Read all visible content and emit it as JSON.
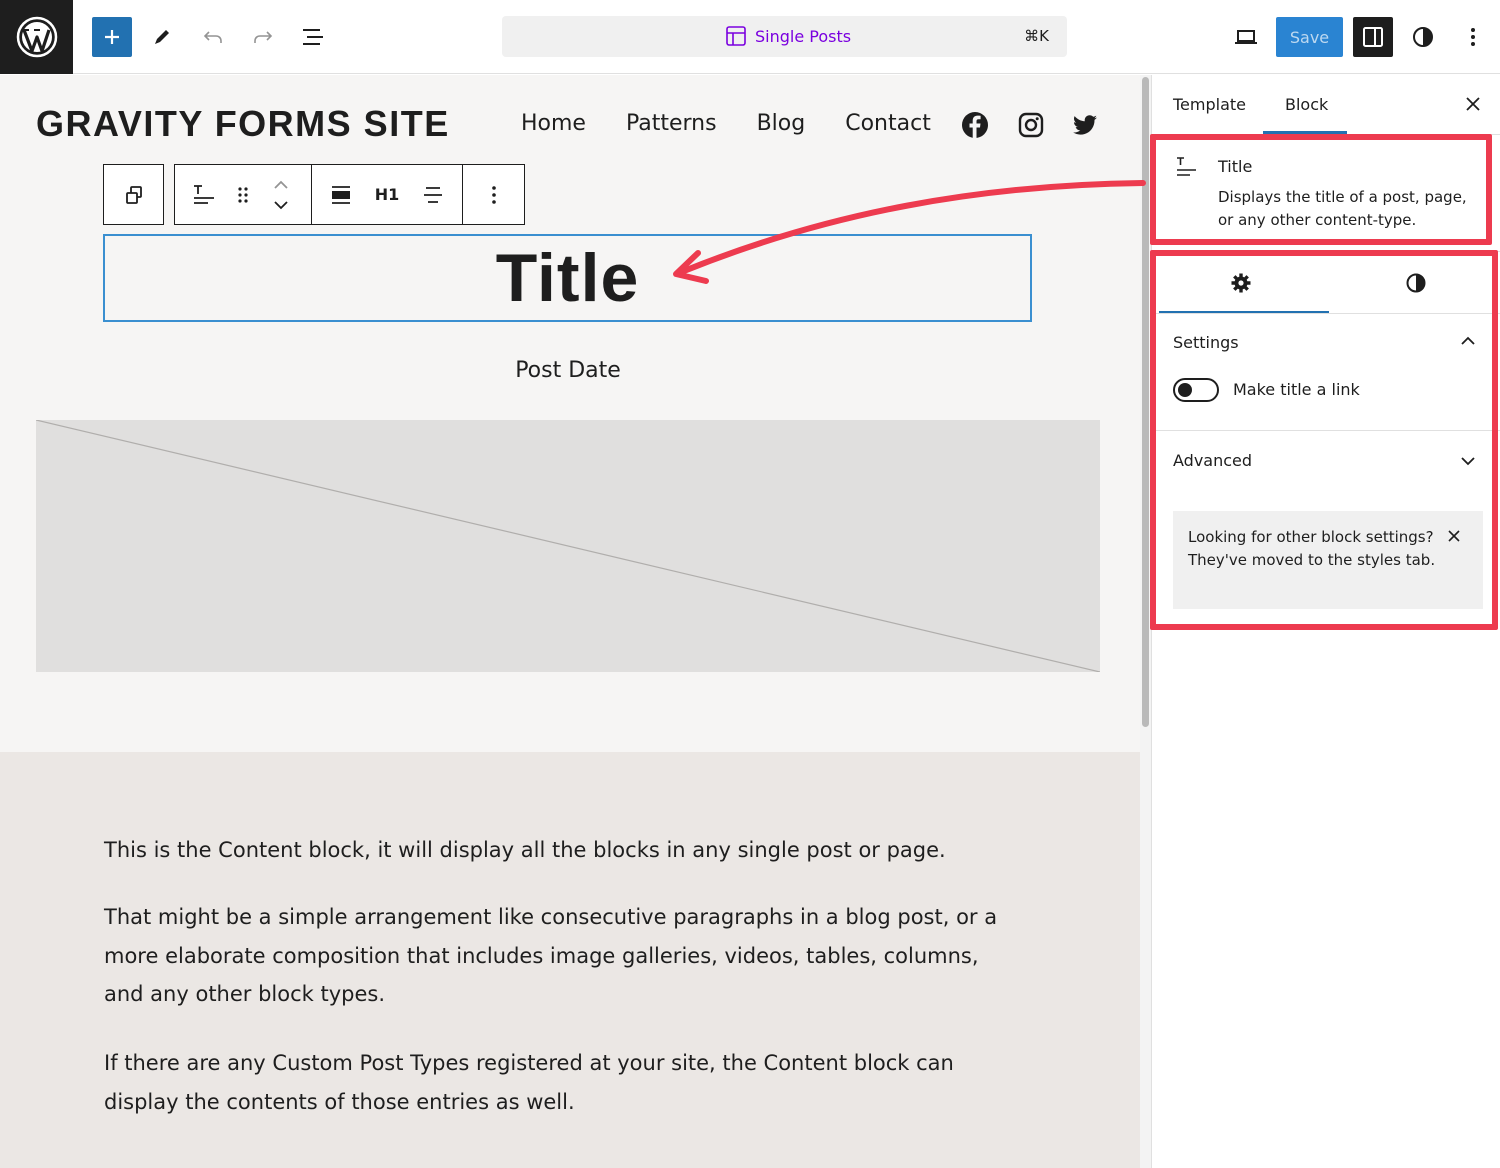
{
  "header": {
    "command_bar": {
      "title": "Single Posts",
      "shortcut": "⌘K"
    },
    "save_label": "Save"
  },
  "site": {
    "title": "GRAVITY FORMS SITE",
    "nav": [
      "Home",
      "Patterns",
      "Blog",
      "Contact"
    ]
  },
  "block_toolbar": {
    "heading_level": "H1"
  },
  "canvas": {
    "post_title": "Title",
    "post_date": "Post Date",
    "content_paragraphs": [
      "This is the Content block, it will display all the blocks in any single post or page.",
      "That might be a simple arrangement like consecutive paragraphs in a blog post, or a more elaborate composition that includes image galleries, videos, tables, columns, and any other block types.",
      "If there are any Custom Post Types registered at your site, the Content block can display the contents of those entries as well."
    ]
  },
  "sidebar": {
    "tabs": [
      "Template",
      "Block"
    ],
    "active_tab": "Block",
    "block_card": {
      "title": "Title",
      "description": "Displays the title of a post, page, or any other content-type."
    },
    "settings_panel": {
      "heading": "Settings",
      "toggle_label": "Make title a link",
      "toggle_on": false
    },
    "advanced_heading": "Advanced",
    "notice": "Looking for other block settings? They've moved to the styles tab."
  },
  "colors": {
    "accent": "#2271b1",
    "command_title": "#7a00df",
    "annotation": "#ed3b4f"
  }
}
